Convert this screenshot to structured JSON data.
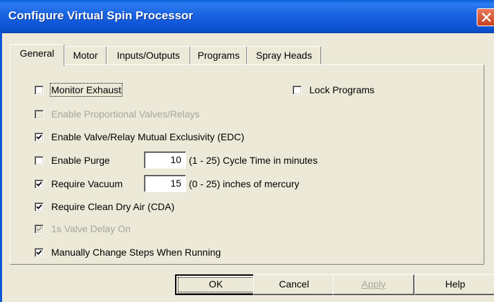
{
  "window": {
    "title": "Configure Virtual Spin Processor"
  },
  "tabs": [
    "General",
    "Motor",
    "Inputs/Outputs",
    "Programs",
    "Spray Heads"
  ],
  "options": {
    "monitor_exhaust": {
      "label": "Monitor Exhaust",
      "checked": false,
      "enabled": true
    },
    "lock_programs": {
      "label": "Lock Programs",
      "checked": false,
      "enabled": true
    },
    "enable_proportional": {
      "label": "Enable Proportional Valves/Relays",
      "checked": false,
      "enabled": false
    },
    "mutual_exclusivity": {
      "label": "Enable Valve/Relay Mutual Exclusivity (EDC)",
      "checked": true,
      "enabled": true
    },
    "enable_purge": {
      "label": "Enable Purge",
      "checked": false,
      "enabled": true
    },
    "require_vacuum": {
      "label": "Require Vacuum",
      "checked": true,
      "enabled": true
    },
    "require_cda": {
      "label": "Require Clean Dry Air (CDA)",
      "checked": true,
      "enabled": true
    },
    "valve_delay": {
      "label": "1s Valve Delay On",
      "checked": true,
      "enabled": false
    },
    "manual_steps": {
      "label": "Manually Change Steps When Running",
      "checked": true,
      "enabled": true
    }
  },
  "purge": {
    "value": "10",
    "hint": "(1 - 25) Cycle Time in minutes"
  },
  "vacuum": {
    "value": "15",
    "hint": "(0 - 25) inches of mercury"
  },
  "buttons": {
    "ok": "OK",
    "cancel": "Cancel",
    "apply": "Apply",
    "help": "Help"
  },
  "colors": {
    "titlebar": "#0d55d6",
    "dialog_bg": "#ece9d8",
    "close": "#c8411d"
  },
  "icons": {
    "close": "close-icon",
    "check": "checkmark-icon"
  }
}
